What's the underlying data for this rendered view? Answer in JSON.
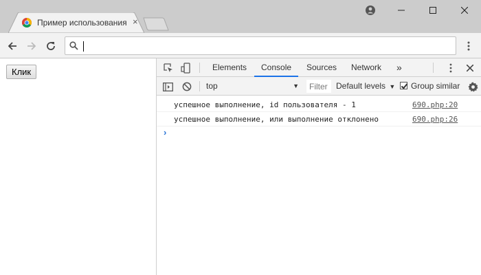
{
  "browser": {
    "tab_title": "Пример использования",
    "tab_close": "×",
    "address_value": "",
    "icons": {
      "favicon": "chrome-icon",
      "user": "user-account-icon",
      "minimize": "minimize-icon",
      "maximize": "maximize-icon",
      "close": "close-icon",
      "back": "back-arrow-icon",
      "forward": "forward-arrow-icon",
      "reload": "reload-icon",
      "search": "search-icon",
      "menu": "kebab-menu-icon"
    }
  },
  "page": {
    "button_label": "Клик"
  },
  "devtools": {
    "tabs": [
      {
        "label": "Elements"
      },
      {
        "label": "Console"
      },
      {
        "label": "Sources"
      },
      {
        "label": "Network"
      }
    ],
    "more_tabs": "»",
    "active_tab": "Console",
    "context": "top",
    "filter_placeholder": "Filter",
    "levels_label": "Default levels",
    "group_similar_label": "Group similar",
    "group_similar_checked": true,
    "accent_color": "#1a73e8",
    "logs": [
      {
        "message": "успешное выполнение, id пользователя - 1",
        "source": "690.php:20"
      },
      {
        "message": "успешное выполнение, или выполнение отклонено",
        "source": "690.php:26"
      }
    ],
    "prompt": "›"
  }
}
